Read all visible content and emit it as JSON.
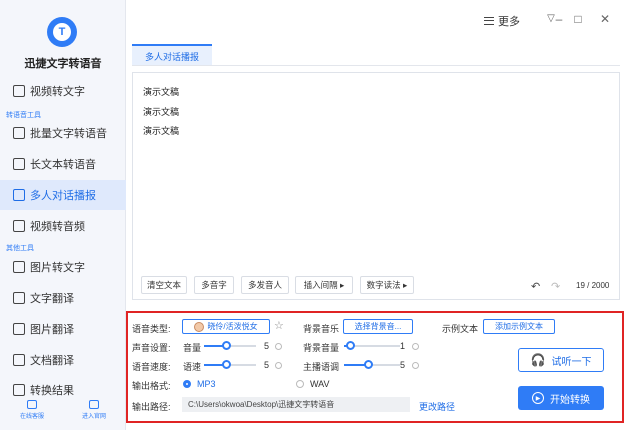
{
  "app": {
    "title": "迅捷文字转语音"
  },
  "titlebar": {
    "more_label": "更多"
  },
  "sidebar": {
    "top_item": "视频转文字",
    "group1": "转语音工具",
    "group1_items": [
      "批量文字转语音",
      "长文本转语音",
      "多人对话播报",
      "视频转音频"
    ],
    "group2": "其他工具",
    "group2_items": [
      "图片转文字",
      "文字翻译",
      "图片翻译",
      "文档翻译"
    ],
    "results": "转换结果",
    "bottom": [
      "在线客服",
      "进入官网"
    ]
  },
  "tab": {
    "label": "多人对话播报"
  },
  "editor": {
    "lines": [
      "演示文稿",
      "演示文稿",
      "演示文稿"
    ],
    "buttons": [
      "清空文本",
      "多音字",
      "多发音人",
      "插入间隔 ▸",
      "数字读法 ▸"
    ],
    "counter": "19 / 2000"
  },
  "settings": {
    "voice_type_label": "语音类型:",
    "voice_name": "晓伶/活泼悦女",
    "bgm_label": "背景音乐",
    "bgm_button": "选择背景音...",
    "sample_label": "示例文本",
    "sample_button": "添加示例文本",
    "sound_label": "声音设置:",
    "volume_label": "音量",
    "volume_value": "5",
    "bg_volume_label": "背景音量",
    "bg_volume_value": "1",
    "speed_label": "语音速度:",
    "speed_sub": "语速",
    "speed_value": "5",
    "gap_label": "主播语调",
    "gap_value": "5",
    "format_label": "输出格式:",
    "format_mp3": "MP3",
    "format_wav": "WAV",
    "path_label": "输出路径:",
    "path_value": "C:\\Users\\okwoa\\Desktop\\迅捷文字转语音",
    "change_path": "更改路径",
    "preview_button": "试听一下",
    "convert_button": "开始转换"
  },
  "colors": {
    "accent": "#2f7cf6",
    "highlight": "#e02424"
  }
}
